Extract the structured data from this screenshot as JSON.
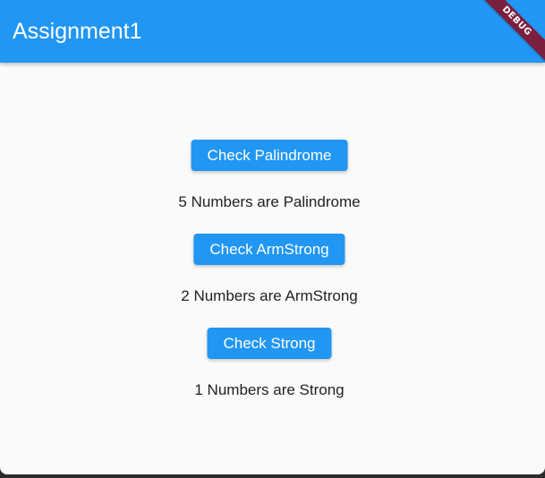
{
  "appbar": {
    "title": "Assignment1",
    "color": "#2196f3"
  },
  "debug_banner": {
    "label": "DEBUG",
    "color": "#7a1f3d"
  },
  "actions": [
    {
      "button_label": "Check Palindrome",
      "result_text": "5 Numbers are Palindrome"
    },
    {
      "button_label": "Check ArmStrong",
      "result_text": "2 Numbers are ArmStrong"
    },
    {
      "button_label": "Check Strong",
      "result_text": "1 Numbers are Strong"
    }
  ]
}
